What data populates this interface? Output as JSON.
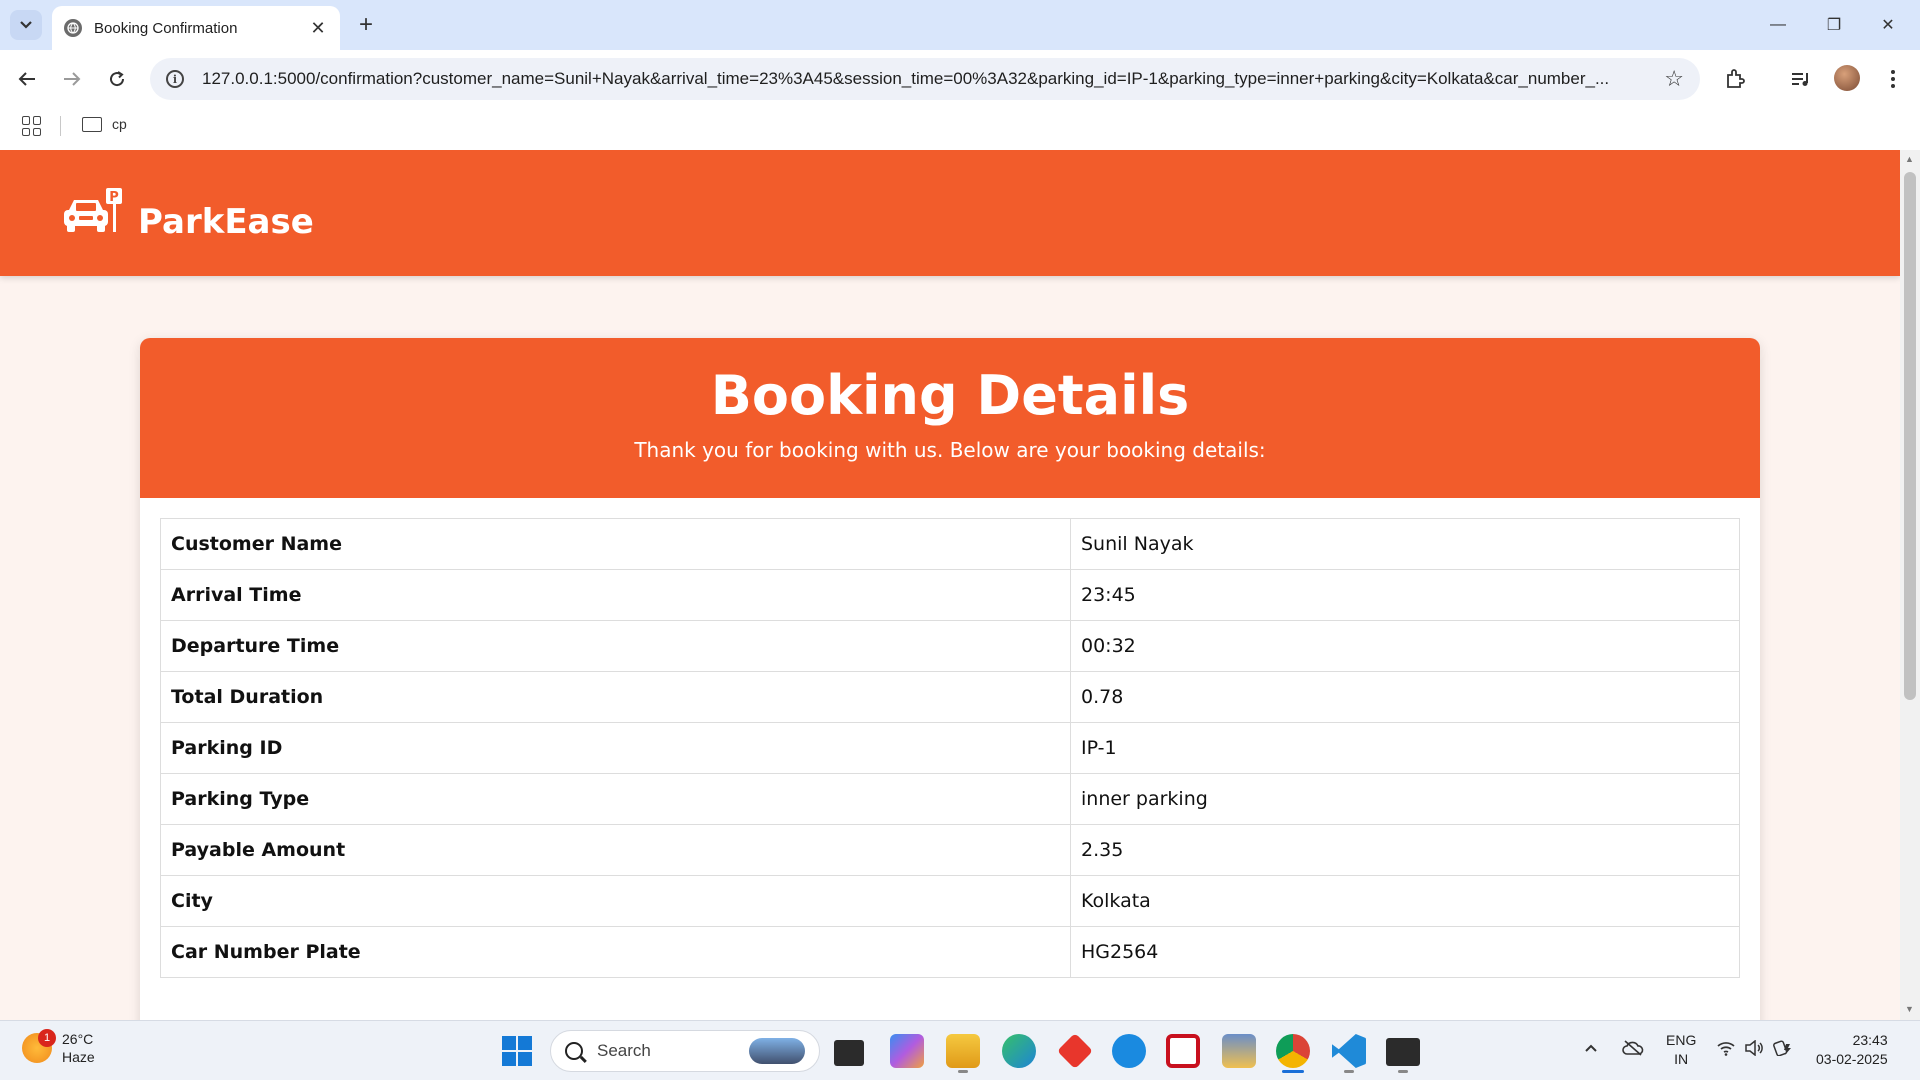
{
  "browser": {
    "tab_title": "Booking Confirmation",
    "url": "127.0.0.1:5000/confirmation?customer_name=Sunil+Nayak&arrival_time=23%3A45&session_time=00%3A32&parking_id=IP-1&parking_type=inner+parking&city=Kolkata&car_number_...",
    "bookmark_folder": "cp",
    "tab_close_glyph": "✕",
    "new_tab_glyph": "+",
    "window_controls": {
      "minimize": "—",
      "restore": "❐",
      "close": "✕"
    }
  },
  "site": {
    "brand": "ParkEase"
  },
  "booking": {
    "title": "Booking Details",
    "subtitle": "Thank you for booking with us. Below are your booking details:",
    "rows": [
      {
        "label": "Customer Name",
        "value": "Sunil Nayak"
      },
      {
        "label": "Arrival Time",
        "value": "23:45"
      },
      {
        "label": "Departure Time",
        "value": "00:32"
      },
      {
        "label": "Total Duration",
        "value": "0.78"
      },
      {
        "label": "Parking ID",
        "value": "IP-1"
      },
      {
        "label": "Parking Type",
        "value": "inner parking"
      },
      {
        "label": "Payable Amount",
        "value": "2.35"
      },
      {
        "label": "City",
        "value": "Kolkata"
      },
      {
        "label": "Car Number Plate",
        "value": "HG2564"
      }
    ]
  },
  "taskbar": {
    "weather_temp": "26°C",
    "weather_desc": "Haze",
    "weather_badge": "1",
    "search_label": "Search",
    "lang_line1": "ENG",
    "lang_line2": "IN",
    "time": "23:43",
    "date": "03-02-2025"
  },
  "colors": {
    "brand_orange": "#f25c2b",
    "page_background": "#fdf3ef"
  }
}
